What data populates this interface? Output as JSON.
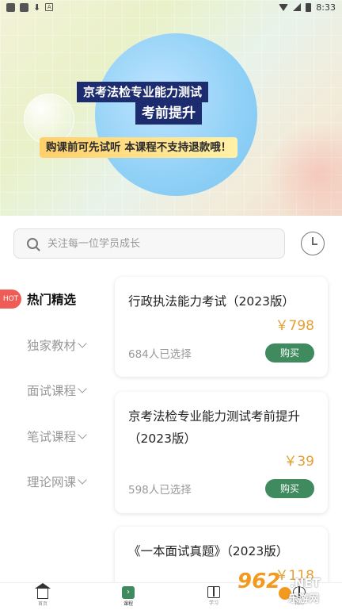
{
  "status_bar": {
    "time": "8:33"
  },
  "banner": {
    "title_line1": "京考法检专业能力测试",
    "title_line2": "考前提升",
    "note": "购课前可先试听  本课程不支持退款哦！"
  },
  "search": {
    "placeholder": "关注每一位学员成长"
  },
  "sidebar": {
    "hot_badge": "HOT",
    "categories": [
      {
        "label": "热门精选"
      },
      {
        "label": "独家教材"
      },
      {
        "label": "面试课程"
      },
      {
        "label": "笔试课程"
      },
      {
        "label": "理论网课"
      }
    ]
  },
  "courses": [
    {
      "title": "行政执法能力考试（2023版）",
      "price": "￥798",
      "count": "684人已选择",
      "buy": "购买"
    },
    {
      "title": "京考法检专业能力测试考前提升（2023版）",
      "price": "￥39",
      "count": "598人已选择",
      "buy": "购买"
    },
    {
      "title": "《一本面试真题》（2023版）",
      "price": "￥118"
    }
  ],
  "bottom_nav": [
    {
      "label": "首页",
      "icon": "home-icon"
    },
    {
      "label": "课程",
      "icon": "course-icon"
    },
    {
      "label": "学习",
      "icon": "book-icon"
    },
    {
      "label": "我的",
      "icon": "user-icon"
    }
  ],
  "watermark": {
    "brand": "962",
    "suffix": ".NET",
    "sub": "乐游网"
  },
  "colors": {
    "accent": "#3f8a5e",
    "price": "#e6a032",
    "hot": "#ef5b55",
    "banner_dark": "#1c2c6e"
  }
}
